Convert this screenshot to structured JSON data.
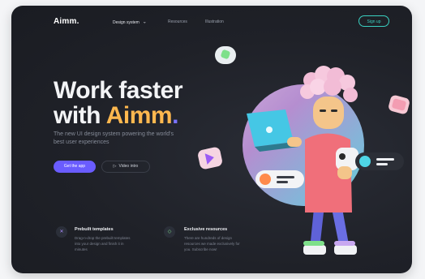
{
  "nav": {
    "logo": "Aimm.",
    "items": [
      {
        "label": "Design system",
        "active": true
      },
      {
        "label": "Resources",
        "active": false
      },
      {
        "label": "Illustration",
        "active": false
      }
    ],
    "signup_label": "Sign up"
  },
  "hero": {
    "title_line1": "Work faster",
    "title_line2_prefix": "with ",
    "title_accent": "Aimm",
    "title_dot": ".",
    "subtitle": "The new UI design system powering the world's best user experiences",
    "primary_button": "Get the app",
    "secondary_button": "Video intro"
  },
  "features": [
    {
      "title": "Prebuilt templates",
      "description": "Drag-n-drop the prebuilt templates into your design and finish it in minutes",
      "icon": "templates-icon"
    },
    {
      "title": "Exclusive resources",
      "description": "There are hundreds of design resources we made exclusively for you. Subscribe now!",
      "icon": "diamond-icon"
    }
  ],
  "colors": {
    "accent_purple": "#6a5cff",
    "accent_orange": "#ffb84f",
    "accent_teal": "#3ad1c2",
    "background": "#1f2128"
  }
}
